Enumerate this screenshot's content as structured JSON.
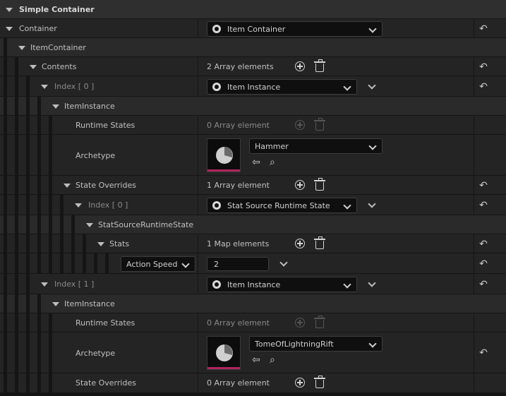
{
  "category": {
    "title": "Simple Container"
  },
  "rows": {
    "container": {
      "label": "Container",
      "value": "Item Container"
    },
    "item_container": {
      "label": "ItemContainer"
    },
    "contents": {
      "label": "Contents",
      "value": "2 Array elements"
    },
    "index0": {
      "label": "Index [ 0 ]",
      "value": "Item Instance"
    },
    "item_instance0": {
      "label": "ItemInstance"
    },
    "runtime_states0": {
      "label": "Runtime States",
      "value": "0 Array element"
    },
    "archetype0": {
      "label": "Archetype",
      "value": "Hammer"
    },
    "state_overrides0": {
      "label": "State Overrides",
      "value": "1 Array element"
    },
    "so_index0": {
      "label": "Index [ 0 ]",
      "value": "Stat Source Runtime State"
    },
    "stat_source": {
      "label": "StatSourceRuntimeState"
    },
    "stats": {
      "label": "Stats",
      "value": "1 Map elements"
    },
    "map_entry": {
      "key": "Action Speed",
      "value": "2"
    },
    "index1": {
      "label": "Index [ 1 ]",
      "value": "Item Instance"
    },
    "item_instance1": {
      "label": "ItemInstance"
    },
    "runtime_states1": {
      "label": "Runtime States",
      "value": "0 Array element"
    },
    "archetype1": {
      "label": "Archetype",
      "value": "TomeOfLightningRift"
    },
    "state_overrides1": {
      "label": "State Overrides",
      "value": "0 Array element"
    }
  },
  "colors": {
    "thumbnail_accent": "#b0245b",
    "background": "#151515",
    "row": "#242424"
  },
  "icons": [
    "expand-arrow-icon",
    "class-icon",
    "reset-arrow-icon",
    "add-icon",
    "trash-icon",
    "browse-asset-icon",
    "find-asset-icon",
    "asset-thumbnail-icon"
  ]
}
